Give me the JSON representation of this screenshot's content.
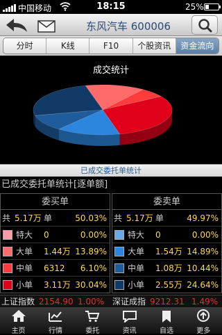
{
  "status_bar": {
    "carrier": "中国移动",
    "time": "18:15",
    "battery": "25%",
    "battery_level": 0.25
  },
  "header": {
    "title": "东风汽车 600006",
    "back_icon": "back-arrow-icon",
    "mail_icon": "envelope-icon",
    "search_icon": "search-icon"
  },
  "tabs": [
    {
      "label": "分时",
      "active": false
    },
    {
      "label": "K线",
      "active": false
    },
    {
      "label": "F10",
      "active": false
    },
    {
      "label": "个股资讯",
      "active": false
    },
    {
      "label": "资金流向",
      "active": true
    }
  ],
  "chart_data": {
    "type": "pie",
    "title": "成交统计",
    "slices": [
      {
        "name": "买-特大",
        "value": 0.0,
        "color": "#ff9aa6"
      },
      {
        "name": "买-大单",
        "value": 13.89,
        "color": "#ff6a6a"
      },
      {
        "name": "买-中单",
        "value": 6.1,
        "color": "#ff3b3b"
      },
      {
        "name": "买-小单",
        "value": 30.04,
        "color": "#e1001a"
      },
      {
        "name": "卖-特大",
        "value": 0.0,
        "color": "#6aa8e8"
      },
      {
        "name": "卖-大单",
        "value": 14.89,
        "color": "#2d86de"
      },
      {
        "name": "卖-中单",
        "value": 10.44,
        "color": "#1e5c9c"
      },
      {
        "name": "卖-小单",
        "value": 24.64,
        "color": "#123a66"
      }
    ]
  },
  "chart_caption": "已成交委托单统计",
  "stats_title": "已成交委托单统计[逐单额]",
  "buy": {
    "header": "委买单",
    "total_label": "共",
    "total_amount": "5.17万",
    "total_unit": "单",
    "total_pct": "50.03%",
    "rows": [
      {
        "cat": "特大",
        "amount": "0",
        "pct": "0.00%",
        "color": "#ff9aa6"
      },
      {
        "cat": "大单",
        "amount": "1.44万",
        "pct": "13.89%",
        "color": "#ff6a6a"
      },
      {
        "cat": "中单",
        "amount": "6312",
        "pct": "6.10%",
        "color": "#ff3b3b"
      },
      {
        "cat": "小单",
        "amount": "3.11万",
        "pct": "30.04%",
        "color": "#e1001a"
      }
    ]
  },
  "sell": {
    "header": "委卖单",
    "total_label": "共",
    "total_amount": "5.17万",
    "total_unit": "单",
    "total_pct": "49.97%",
    "rows": [
      {
        "cat": "特大",
        "amount": "0",
        "pct": "0.00%",
        "color": "#6aa8e8"
      },
      {
        "cat": "大单",
        "amount": "1.54万",
        "pct": "14.89%",
        "color": "#2d86de"
      },
      {
        "cat": "中单",
        "amount": "1.08万",
        "pct": "10.44%",
        "color": "#1e5c9c"
      },
      {
        "cat": "小单",
        "amount": "2.55万",
        "pct": "24.64%",
        "color": "#123a66"
      }
    ]
  },
  "ticker": {
    "sh_label": "上证指数",
    "sh_value": "2154.90",
    "sh_change": "1.00%",
    "sz_label": "深证成指",
    "sz_value": "9212.31",
    "sz_change": "1.49%"
  },
  "tabbar": [
    {
      "label": "主页",
      "icon": "home-icon"
    },
    {
      "label": "行情",
      "icon": "chart-icon"
    },
    {
      "label": "委托",
      "icon": "cart-icon"
    },
    {
      "label": "资讯",
      "icon": "chat-bubble-icon"
    },
    {
      "label": "自选",
      "icon": "bookmark-icon"
    },
    {
      "label": "更多",
      "icon": "more-arrow-icon"
    }
  ]
}
